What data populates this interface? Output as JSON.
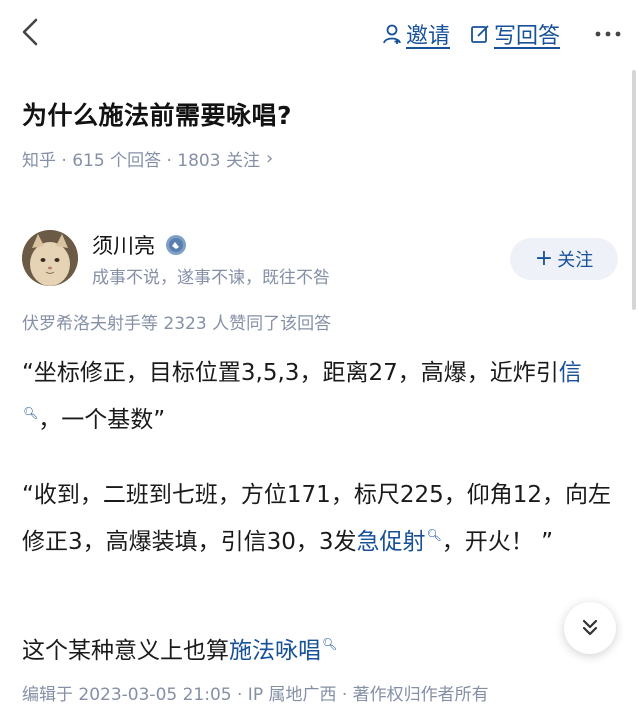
{
  "header": {
    "invite_label": "邀请",
    "write_answer_label": "写回答",
    "more_label": "···"
  },
  "question": {
    "title": "为什么施法前需要咏唱?",
    "meta": "知乎 · 615 个回答 · 1803 关注",
    "chevron": "›"
  },
  "author": {
    "name": "须川亮",
    "bio": "成事不说，遂事不谏，既往不咎",
    "follow_label": "关注",
    "follow_plus": "+"
  },
  "answer": {
    "voters": "伏罗希洛夫射手等 2323 人赞同了该回答",
    "p1_text": "“坐标修正，目标位置3,5,3，距离27，高爆，近炸引",
    "p1_link": "信",
    "p1_tail": "，一个基数”",
    "p2_text": "“收到，二班到七班，方位171，标尺225，仰角12，向左修正3，高爆装填，引信30，3发",
    "p2_link": "急促射",
    "p2_tail": "，开火！ ”",
    "p3_text": "这个某种意义上也算",
    "p3_link": "施法咏唱",
    "edited": "编辑于 2023-03-05 21:05 · IP 属地广西 · 著作权归作者所有"
  },
  "colors": {
    "link": "#175199",
    "meta": "#8590a6",
    "text": "#1a1a1a"
  },
  "icons": {
    "back": "chevron-left-icon",
    "invite": "person-icon",
    "answer": "edit-icon",
    "more": "more-dots-icon",
    "search_hint": "search-icon",
    "collapse": "double-chevron-down-icon"
  }
}
